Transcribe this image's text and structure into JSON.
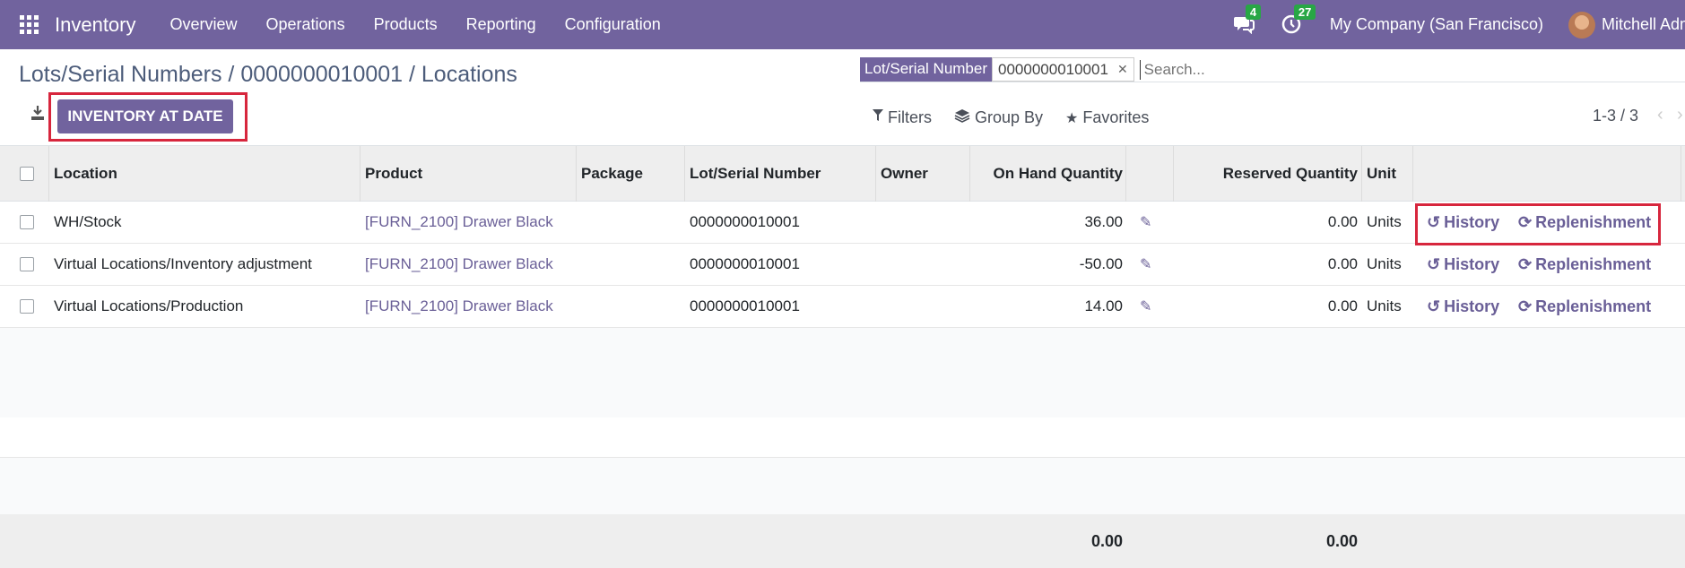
{
  "topbar": {
    "app_name": "Inventory",
    "menu": [
      "Overview",
      "Operations",
      "Products",
      "Reporting",
      "Configuration"
    ],
    "messages_count": "4",
    "activities_count": "27",
    "company": "My Company (San Francisco)",
    "user": "Mitchell Admin"
  },
  "breadcrumb": "Lots/Serial Numbers / 0000000010001 / Locations",
  "buttons": {
    "inventory_at_date": "INVENTORY AT DATE"
  },
  "search": {
    "facet_label": "Lot/Serial Number",
    "facet_value": "0000000010001",
    "placeholder": "Search..."
  },
  "filters": {
    "filters": "Filters",
    "group_by": "Group By",
    "favorites": "Favorites"
  },
  "pager": "1-3 / 3",
  "table": {
    "headers": {
      "location": "Location",
      "product": "Product",
      "package": "Package",
      "lot": "Lot/Serial Number",
      "owner": "Owner",
      "on_hand": "On Hand Quantity",
      "reserved": "Reserved Quantity",
      "unit": "Unit"
    },
    "rows": [
      {
        "location": "WH/Stock",
        "product": "[FURN_2100] Drawer Black",
        "lot": "0000000010001",
        "on_hand": "36.00",
        "reserved": "0.00",
        "unit": "Units",
        "history": "History",
        "replenishment": "Replenishment"
      },
      {
        "location": "Virtual Locations/Inventory adjustment",
        "product": "[FURN_2100] Drawer Black",
        "lot": "0000000010001",
        "on_hand": "-50.00",
        "reserved": "0.00",
        "unit": "Units",
        "history": "History",
        "replenishment": "Replenishment"
      },
      {
        "location": "Virtual Locations/Production",
        "product": "[FURN_2100] Drawer Black",
        "lot": "0000000010001",
        "on_hand": "14.00",
        "reserved": "0.00",
        "unit": "Units",
        "history": "History",
        "replenishment": "Replenishment"
      }
    ],
    "totals": {
      "on_hand": "0.00",
      "reserved": "0.00"
    }
  },
  "colors": {
    "brand": "#71639e",
    "highlight": "#d7263d",
    "badge": "#28a745"
  }
}
